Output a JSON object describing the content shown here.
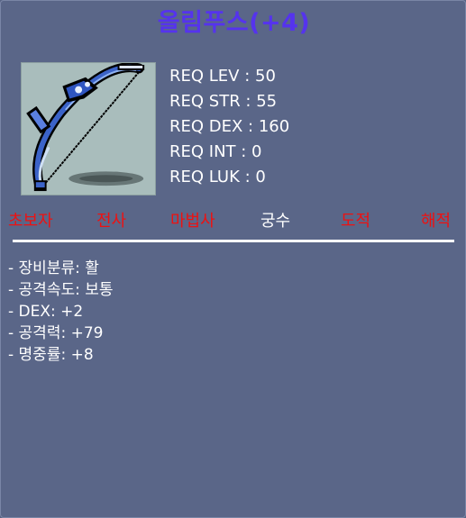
{
  "item": {
    "title": "올림푸스(+4)",
    "icon": "bow-icon"
  },
  "requirements": [
    {
      "label": "REQ LEV : 50"
    },
    {
      "label": "REQ STR : 55"
    },
    {
      "label": "REQ DEX : 160"
    },
    {
      "label": "REQ INT : 0"
    },
    {
      "label": "REQ LUK : 0"
    }
  ],
  "jobs": [
    {
      "name": "초보자",
      "color": "#ee1111"
    },
    {
      "name": "전사",
      "color": "#ee1111"
    },
    {
      "name": "마법사",
      "color": "#ee1111"
    },
    {
      "name": "궁수",
      "color": "#ffffff"
    },
    {
      "name": "도적",
      "color": "#ee1111"
    },
    {
      "name": "해적",
      "color": "#ee1111"
    }
  ],
  "stats": [
    {
      "text": "- 장비분류: 활"
    },
    {
      "text": "- 공격속도: 보통"
    },
    {
      "text": "- DEX: +2"
    },
    {
      "text": "- 공격력: +79"
    },
    {
      "text": "- 명중률: +8"
    }
  ],
  "colors": {
    "background": "#5a6688",
    "title": "#5533ee",
    "restricted_job": "#ee1111",
    "available_job": "#ffffff"
  }
}
